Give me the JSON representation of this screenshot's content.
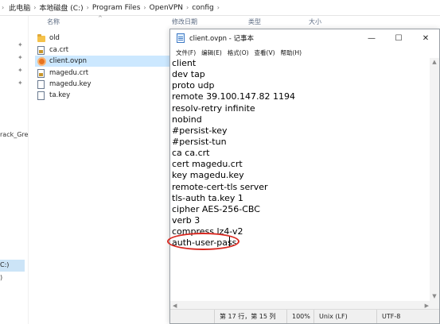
{
  "breadcrumb": {
    "items": [
      "此电脑",
      "本地磁盘 (C:)",
      "Program Files",
      "OpenVPN",
      "config"
    ],
    "separator": "›"
  },
  "explorer": {
    "columns": {
      "name": "名称",
      "modified": "修改日期",
      "type": "类型",
      "size": "大小"
    },
    "nav_text": {
      "track": "rack_Gre",
      "drive": "C:)",
      "paren": ")"
    },
    "files": [
      {
        "name": "old",
        "icon": "folder-icon"
      },
      {
        "name": "ca.crt",
        "icon": "certificate-file-icon"
      },
      {
        "name": "client.ovpn",
        "icon": "openvpn-config-icon",
        "selected": true
      },
      {
        "name": "magedu.crt",
        "icon": "certificate-file-icon"
      },
      {
        "name": "magedu.key",
        "icon": "file-icon"
      },
      {
        "name": "ta.key",
        "icon": "file-icon"
      }
    ]
  },
  "notepad": {
    "title": "client.ovpn - 记事本",
    "window_controls": {
      "minimize": "—",
      "maximize": "☐",
      "close": "✕"
    },
    "menu": [
      "文件(F)",
      "编辑(E)",
      "格式(O)",
      "查看(V)",
      "帮助(H)"
    ],
    "lines": [
      "client",
      "dev tap",
      "proto udp",
      "remote 39.100.147.82 1194",
      "resolv-retry infinite",
      "nobind",
      "#persist-key",
      "#persist-tun",
      "ca ca.crt",
      "cert magedu.crt",
      "key magedu.key",
      "remote-cert-tls server",
      "tls-auth ta.key 1",
      "cipher AES-256-CBC",
      "verb 3",
      "compress lz4-v2",
      "auth-user-pass"
    ],
    "status": {
      "position": "第 17 行，第 15 列",
      "zoom": "100%",
      "line_ending": "Unix (LF)",
      "encoding": "UTF-8"
    }
  },
  "colors": {
    "annotation": "#d9271f",
    "selection": "#cce8ff",
    "status_bar": "#f0f0f0"
  }
}
